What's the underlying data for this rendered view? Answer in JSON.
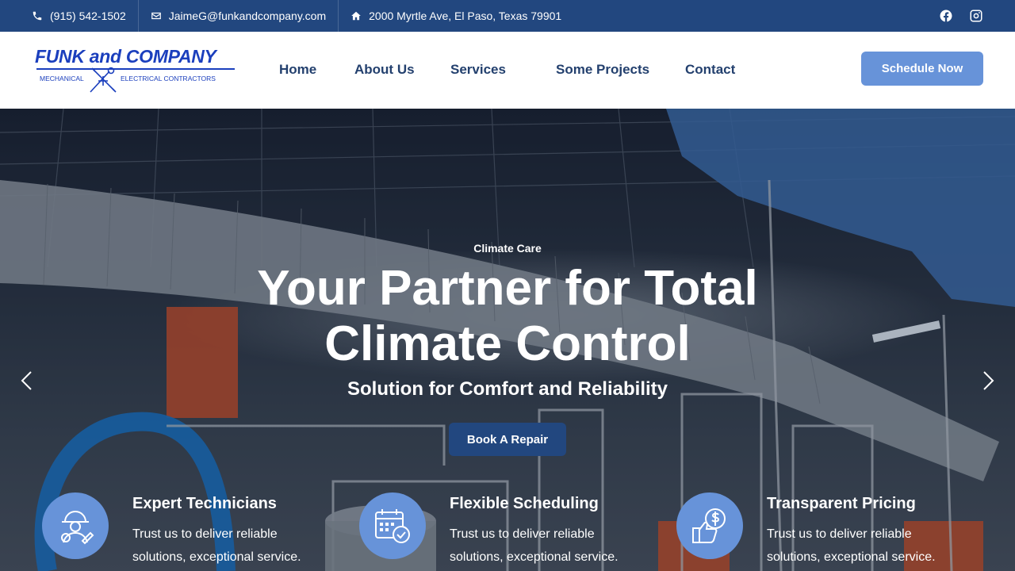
{
  "topbar": {
    "phone": "(915) 542-1502",
    "email": "JaimeG@funkandcompany.com",
    "address": "2000 Myrtle Ave, El Paso, Texas 79901",
    "social": [
      "facebook-icon",
      "instagram-icon"
    ]
  },
  "logo": {
    "title": "FUNK and COMPANY",
    "sub_left": "MECHANICAL",
    "sub_right": "ELECTRICAL CONTRACTORS"
  },
  "nav": {
    "items": [
      "Home",
      "About Us",
      "Services",
      "Some Projects",
      "Contact"
    ]
  },
  "header": {
    "cta": "Schedule Now"
  },
  "hero": {
    "eyebrow": "Climate Care",
    "headline_line1": "Your Partner for Total",
    "headline_line2": "Climate Control",
    "subhead": "Solution for Comfort and Reliability",
    "button": "Book A Repair"
  },
  "features": [
    {
      "title": "Expert Technicians",
      "text": "Trust us to deliver reliable solutions, exceptional service.",
      "icon": "technician-icon"
    },
    {
      "title": "Flexible Scheduling",
      "text": "Trust us to deliver reliable solutions, exceptional service.",
      "icon": "calendar-clock-icon"
    },
    {
      "title": "Transparent Pricing",
      "text": "Trust us to deliver reliable solutions, exceptional service.",
      "icon": "thumbs-up-dollar-icon"
    }
  ],
  "colors": {
    "topbar_bg": "#22477f",
    "nav_text": "#23406e",
    "accent": "#6793d9",
    "primary_button": "#22477f",
    "logo_blue": "#1b3fbd"
  }
}
